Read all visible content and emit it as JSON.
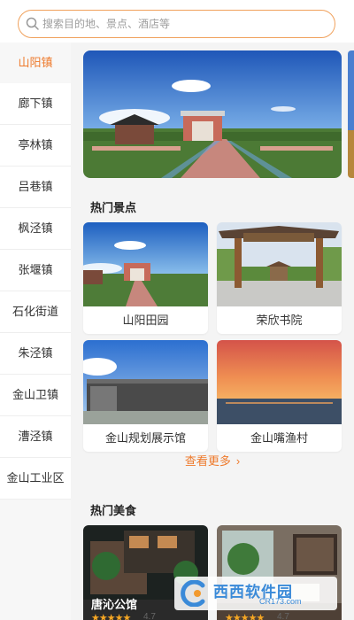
{
  "search": {
    "placeholder": "搜索目的地、景点、酒店等",
    "value": ""
  },
  "sidebar": {
    "items": [
      {
        "label": "山阳镇",
        "active": true
      },
      {
        "label": "廊下镇"
      },
      {
        "label": "亭林镇"
      },
      {
        "label": "吕巷镇"
      },
      {
        "label": "枫泾镇"
      },
      {
        "label": "张堰镇"
      },
      {
        "label": "石化街道"
      },
      {
        "label": "朱泾镇"
      },
      {
        "label": "金山卫镇"
      },
      {
        "label": "漕泾镇"
      },
      {
        "label": "金山工业区"
      }
    ]
  },
  "sections": {
    "attractions": {
      "title": "热门景点",
      "cards": [
        {
          "label": "山阳田园"
        },
        {
          "label": "荣欣书院"
        },
        {
          "label": "金山规划展示馆"
        },
        {
          "label": "金山嘴渔村"
        }
      ],
      "more_label": "查看更多",
      "more_icon": "chevron-right-icon"
    },
    "food": {
      "title": "热门美食",
      "cards": [
        {
          "name": "唐沁公馆",
          "stars": "★★★★★",
          "rating": "4.7"
        },
        {
          "name": "",
          "stars": "★★★★★",
          "rating": "4.7"
        }
      ]
    }
  },
  "watermark": {
    "name": "西西软件园",
    "url": "CR173.com"
  },
  "colors": {
    "accent": "#ee7a2c",
    "search_border": "#f0a15c",
    "star": "#f5a623"
  }
}
